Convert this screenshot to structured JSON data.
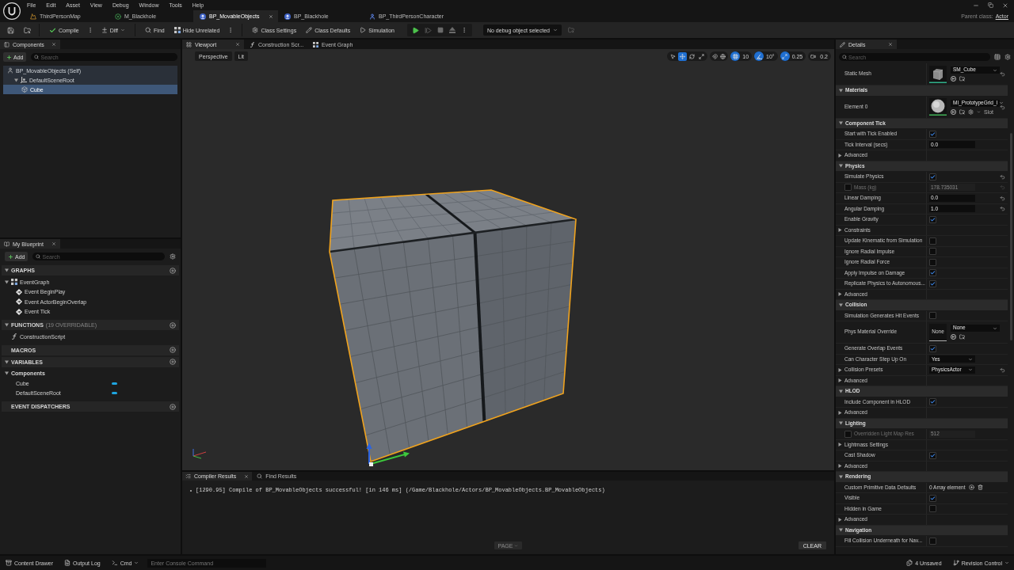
{
  "menu_bar": {
    "items": [
      "File",
      "Edit",
      "Asset",
      "View",
      "Debug",
      "Window",
      "Tools",
      "Help"
    ]
  },
  "document_tabs": [
    {
      "label": "ThirdPersonMap",
      "kind": "map",
      "selected": false
    },
    {
      "label": "M_Blackhole",
      "kind": "material",
      "selected": false
    },
    {
      "label": "BP_MovableObjects",
      "kind": "blueprint",
      "selected": true
    },
    {
      "label": "BP_Blackhole",
      "kind": "blueprint",
      "selected": false
    },
    {
      "label": "BP_ThirdPersonCharacter",
      "kind": "character",
      "selected": false
    }
  ],
  "parent_class": {
    "label": "Parent class:",
    "value": "Actor"
  },
  "toolbar": {
    "groups": [
      [
        {
          "label": "Compile",
          "kind": "compile",
          "options": true,
          "dropdown": false
        },
        {
          "label": "Diff",
          "kind": "diff",
          "options": false,
          "dropdown": true
        }
      ],
      [
        {
          "label": "Find",
          "kind": "find",
          "options": false,
          "dropdown": false
        },
        {
          "label": "Hide Unrelated",
          "kind": "hide",
          "options": true,
          "dropdown": false
        }
      ],
      [
        {
          "label": "Class Settings",
          "kind": "settings",
          "options": false,
          "dropdown": false
        },
        {
          "label": "Class Defaults",
          "kind": "defaults",
          "options": false,
          "dropdown": false
        },
        {
          "label": "Simulation",
          "kind": "simulation",
          "options": false,
          "dropdown": false
        }
      ]
    ],
    "play_controls": [
      {
        "kind": "play",
        "disabled": false
      },
      {
        "kind": "step",
        "disabled": true
      },
      {
        "kind": "stop",
        "disabled": true
      },
      {
        "kind": "eject",
        "disabled": true
      }
    ],
    "debug_filter": {
      "value": "No debug object selected"
    }
  },
  "components_panel": {
    "title": "Components",
    "add_label": "Add",
    "search_placeholder": "Search",
    "tree": [
      {
        "label": "BP_MovableObjects (Self)",
        "kind": "actor",
        "selected": false,
        "children": [
          {
            "label": "DefaultSceneRoot",
            "kind": "scene",
            "selected": false,
            "expanded": true,
            "children": [
              {
                "label": "Cube",
                "kind": "mesh",
                "selected": true
              }
            ]
          }
        ]
      }
    ]
  },
  "my_blueprint": {
    "title": "My Blueprint",
    "add_label": "Add",
    "search_placeholder": "Search",
    "sections": [
      {
        "title": "GRAPHS",
        "expanded": true,
        "items": [
          {
            "label": "EventGraph",
            "kind": "graph",
            "expanded": true,
            "children": [
              {
                "label": "Event BeginPlay",
                "kind": "event"
              },
              {
                "label": "Event ActorBeginOverlap",
                "kind": "event"
              },
              {
                "label": "Event Tick",
                "kind": "event"
              }
            ]
          }
        ]
      },
      {
        "title": "FUNCTIONS",
        "note": "(19 OVERRIDABLE)",
        "expanded": true,
        "items": [
          {
            "label": "ConstructionScript",
            "kind": "function"
          }
        ]
      },
      {
        "title": "MACROS"
      },
      {
        "title": "VARIABLES",
        "expanded": true,
        "items": [
          {
            "label": "Components",
            "kind": "category",
            "expanded": true,
            "children": [
              {
                "label": "Cube",
                "kind": "variable",
                "color": "#1ea5e0"
              },
              {
                "label": "DefaultSceneRoot",
                "kind": "variable",
                "color": "#1ea5e0"
              }
            ]
          }
        ]
      },
      {
        "title": "EVENT DISPATCHERS"
      }
    ]
  },
  "editor_tabs": [
    {
      "label": "Viewport",
      "kind": "viewport",
      "selected": true
    },
    {
      "label": "Construction Scr...",
      "kind": "function",
      "selected": false
    },
    {
      "label": "Event Graph",
      "kind": "graph",
      "selected": false
    }
  ],
  "viewport": {
    "view_mode": "Perspective",
    "lighting": "Lit",
    "transform_tools": [
      {
        "kind": "select",
        "selected": false
      },
      {
        "kind": "move",
        "selected": true
      },
      {
        "kind": "rotate",
        "selected": false
      },
      {
        "kind": "scale",
        "selected": false
      }
    ],
    "snaps": [
      {
        "kind": "grid",
        "value": "10",
        "on": true
      },
      {
        "kind": "angle",
        "value": "10°",
        "on": true
      },
      {
        "kind": "scale",
        "value": "0.25",
        "on": true
      },
      {
        "kind": "camera",
        "value": "0.2",
        "on": false
      }
    ]
  },
  "output_panel": {
    "tabs": [
      {
        "label": "Compiler Results",
        "kind": "compiler",
        "selected": true
      },
      {
        "label": "Find Results",
        "kind": "find",
        "selected": false
      }
    ],
    "messages": [
      "[1290.95] Compile of BP_MovableObjects successful! [in 146 ms] (/Game/Blackhole/Actors/BP_MovableObjects.BP_MovableObjects)"
    ],
    "page_button": {
      "label": "PAGE",
      "disabled": true
    },
    "clear_button": {
      "label": "CLEAR"
    }
  },
  "details": {
    "title": "Details",
    "search_placeholder": "Search",
    "rows": [
      {
        "kind": "asset",
        "label": "Static Mesh",
        "thumbnail": {
          "kind": "cube"
        },
        "value": "SM_Cube",
        "reset": true
      },
      {
        "kind": "section",
        "label": "Materials",
        "expanded": true
      },
      {
        "kind": "asset",
        "label": "Element 0",
        "thumbnail": {
          "kind": "sphere"
        },
        "value": "MI_PrototypeGrid_I",
        "slot_label": "Slot",
        "reset": true
      },
      {
        "kind": "section",
        "label": "Component Tick",
        "expanded": true
      },
      {
        "kind": "checkbox",
        "label": "Start with Tick Enabled",
        "checked": true,
        "reset": false
      },
      {
        "kind": "number",
        "label": "Tick Interval (secs)",
        "value": "0.0",
        "reset": false
      },
      {
        "kind": "group",
        "label": "Advanced",
        "expanded": false,
        "reset": false
      },
      {
        "kind": "section",
        "label": "Physics",
        "expanded": true
      },
      {
        "kind": "checkbox",
        "label": "Simulate Physics",
        "checked": true,
        "reset": true
      },
      {
        "kind": "optional_number",
        "label": "Mass (kg)",
        "checked": false,
        "value": "178.735031",
        "reset": true
      },
      {
        "kind": "number",
        "label": "Linear Damping",
        "value": "0.0",
        "reset": true
      },
      {
        "kind": "number",
        "label": "Angular Damping",
        "value": "1.0",
        "reset": true
      },
      {
        "kind": "checkbox",
        "label": "Enable Gravity",
        "checked": true,
        "reset": false
      },
      {
        "kind": "group",
        "label": "Constraints",
        "expanded": false,
        "reset": false
      },
      {
        "kind": "checkbox",
        "label": "Update Kinematic from Simulation",
        "checked": false,
        "reset": false
      },
      {
        "kind": "checkbox",
        "label": "Ignore Radial Impulse",
        "checked": false,
        "reset": false
      },
      {
        "kind": "checkbox",
        "label": "Ignore Radial Force",
        "checked": false,
        "reset": false
      },
      {
        "kind": "checkbox",
        "label": "Apply Impulse on Damage",
        "checked": true,
        "reset": false
      },
      {
        "kind": "checkbox",
        "label": "Replicate Physics to Autonomous...",
        "checked": true,
        "reset": false
      },
      {
        "kind": "group",
        "label": "Advanced",
        "expanded": false,
        "reset": false
      },
      {
        "kind": "section",
        "label": "Collision",
        "expanded": true
      },
      {
        "kind": "checkbox",
        "label": "Simulation Generates Hit Events",
        "checked": false,
        "reset": false
      },
      {
        "kind": "asset",
        "label": "Phys Material Override",
        "thumbnail": {
          "kind": "empty",
          "text": "None"
        },
        "value": "None",
        "reset": false
      },
      {
        "kind": "checkbox",
        "label": "Generate Overlap Events",
        "checked": true,
        "reset": false
      },
      {
        "kind": "dropdown",
        "label": "Can Character Step Up On",
        "value": "Yes",
        "reset": false
      },
      {
        "kind": "group",
        "label": "Collision Presets",
        "expanded": false,
        "value": "PhysicsActor",
        "reset": true
      },
      {
        "kind": "group",
        "label": "Advanced",
        "expanded": false,
        "reset": false
      },
      {
        "kind": "section",
        "label": "HLOD",
        "expanded": true
      },
      {
        "kind": "checkbox",
        "label": "Include Component in HLOD",
        "checked": true,
        "reset": false
      },
      {
        "kind": "group",
        "label": "Advanced",
        "expanded": false,
        "reset": false
      },
      {
        "kind": "section",
        "label": "Lighting",
        "expanded": true
      },
      {
        "kind": "optional_number",
        "label": "Overridden Light Map Res",
        "checked": false,
        "value": "512",
        "reset": false
      },
      {
        "kind": "group",
        "label": "Lightmass Settings",
        "expanded": false,
        "reset": false
      },
      {
        "kind": "checkbox",
        "label": "Cast Shadow",
        "checked": true,
        "reset": false
      },
      {
        "kind": "group",
        "label": "Advanced",
        "expanded": false,
        "reset": false
      },
      {
        "kind": "section",
        "label": "Rendering",
        "expanded": true
      },
      {
        "kind": "array",
        "label": "Custom Primitive Data Defaults",
        "value": "0 Array element",
        "reset": false
      },
      {
        "kind": "checkbox",
        "label": "Visible",
        "checked": true,
        "reset": false
      },
      {
        "kind": "checkbox",
        "label": "Hidden in Game",
        "checked": false,
        "reset": false
      },
      {
        "kind": "group",
        "label": "Advanced",
        "expanded": false,
        "reset": false
      },
      {
        "kind": "section",
        "label": "Navigation",
        "expanded": true
      },
      {
        "kind": "checkbox",
        "label": "Fill Collision Underneath for Nav...",
        "checked": false,
        "reset": false
      }
    ]
  },
  "status_bar": {
    "buttons": [
      {
        "label": "Content Drawer",
        "kind": "drawer",
        "dropdown": false
      },
      {
        "label": "Output Log",
        "kind": "log",
        "dropdown": false
      },
      {
        "label": "Cmd",
        "kind": "cmd",
        "dropdown": true
      }
    ],
    "console_placeholder": "Enter Console Command",
    "unsaved": "4 Unsaved",
    "revision_control": "Revision Control"
  }
}
